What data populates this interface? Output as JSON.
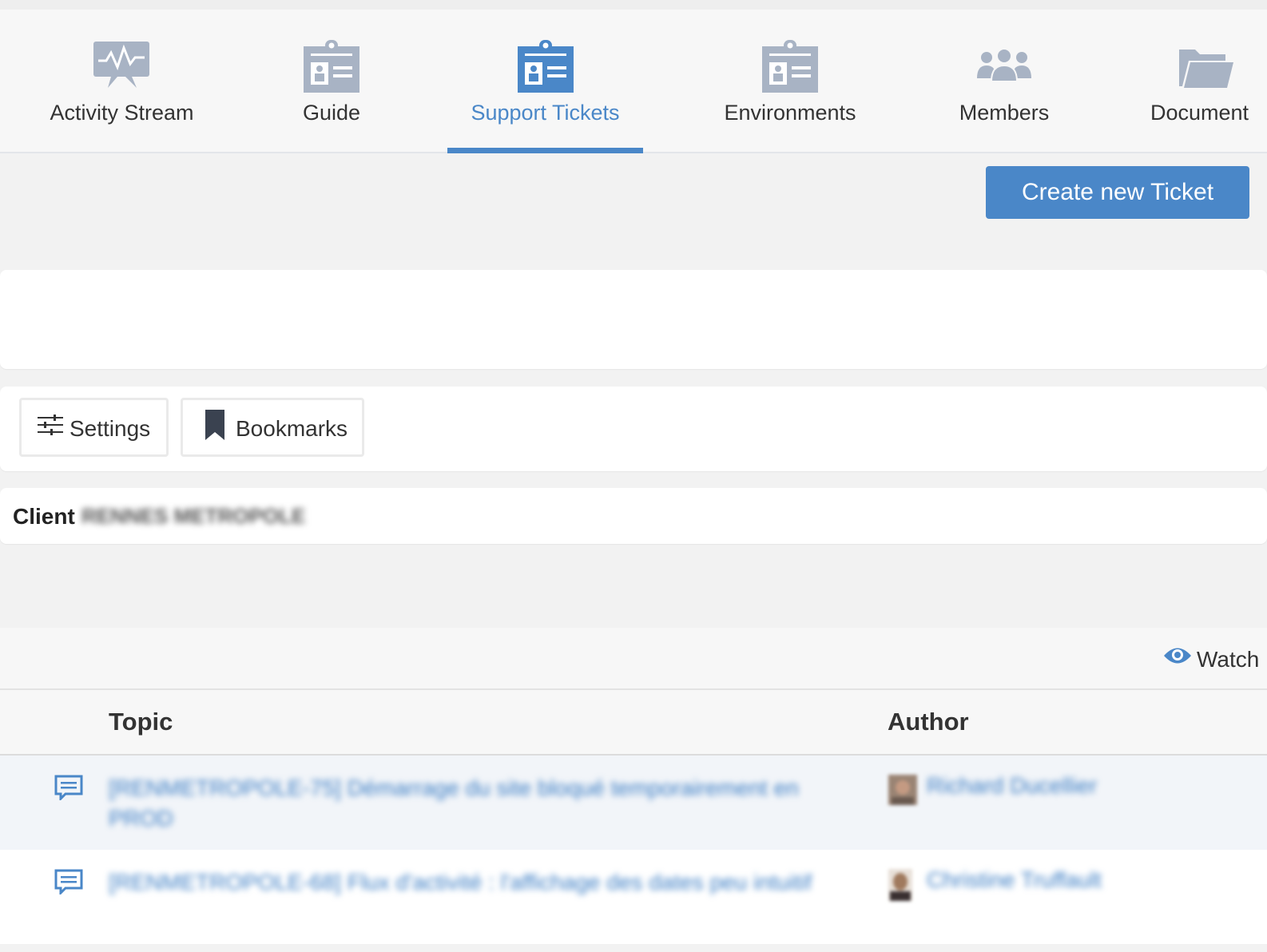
{
  "tabs": [
    {
      "label": "Activity Stream",
      "icon": "activity-stream-icon",
      "active": false
    },
    {
      "label": "Guide",
      "icon": "clipboard-badge-icon",
      "active": false
    },
    {
      "label": "Support Tickets",
      "icon": "clipboard-badge-icon",
      "active": true
    },
    {
      "label": "Environments",
      "icon": "clipboard-badge-icon",
      "active": false
    },
    {
      "label": "Members",
      "icon": "members-group-icon",
      "active": false
    },
    {
      "label": "Document",
      "icon": "folder-open-icon",
      "active": false
    }
  ],
  "actions": {
    "create_ticket": "Create new Ticket"
  },
  "toolbar": {
    "settings": "Settings",
    "bookmarks": "Bookmarks"
  },
  "client": {
    "label": "Client",
    "value": "RENNES METROPOLE"
  },
  "watch": {
    "label": "Watch"
  },
  "table": {
    "columns": [
      "Topic",
      "Author"
    ],
    "rows": [
      {
        "topic": "[RENMETROPOLE-75] Démarrage du site bloqué temporairement en PROD",
        "author": "Richard Ducellier"
      },
      {
        "topic": "[RENMETROPOLE-68] Flux d'activité : l'affichage des dates peu intuitif",
        "author": "Christine Truffault"
      }
    ]
  },
  "colors": {
    "accent": "#4a87c8",
    "icon_gray": "#a8b3c4",
    "link_blue": "#3b7dc4",
    "background": "#f2f2f2"
  }
}
